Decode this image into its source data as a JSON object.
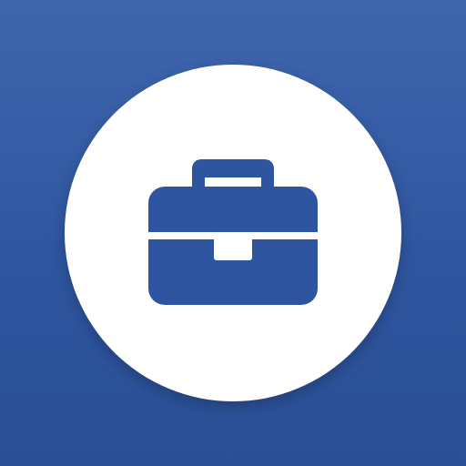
{
  "icon": {
    "name": "briefcase-icon",
    "background_color": "#2f56a0",
    "circle_color": "#ffffff",
    "glyph_color": "#2f55a0"
  }
}
